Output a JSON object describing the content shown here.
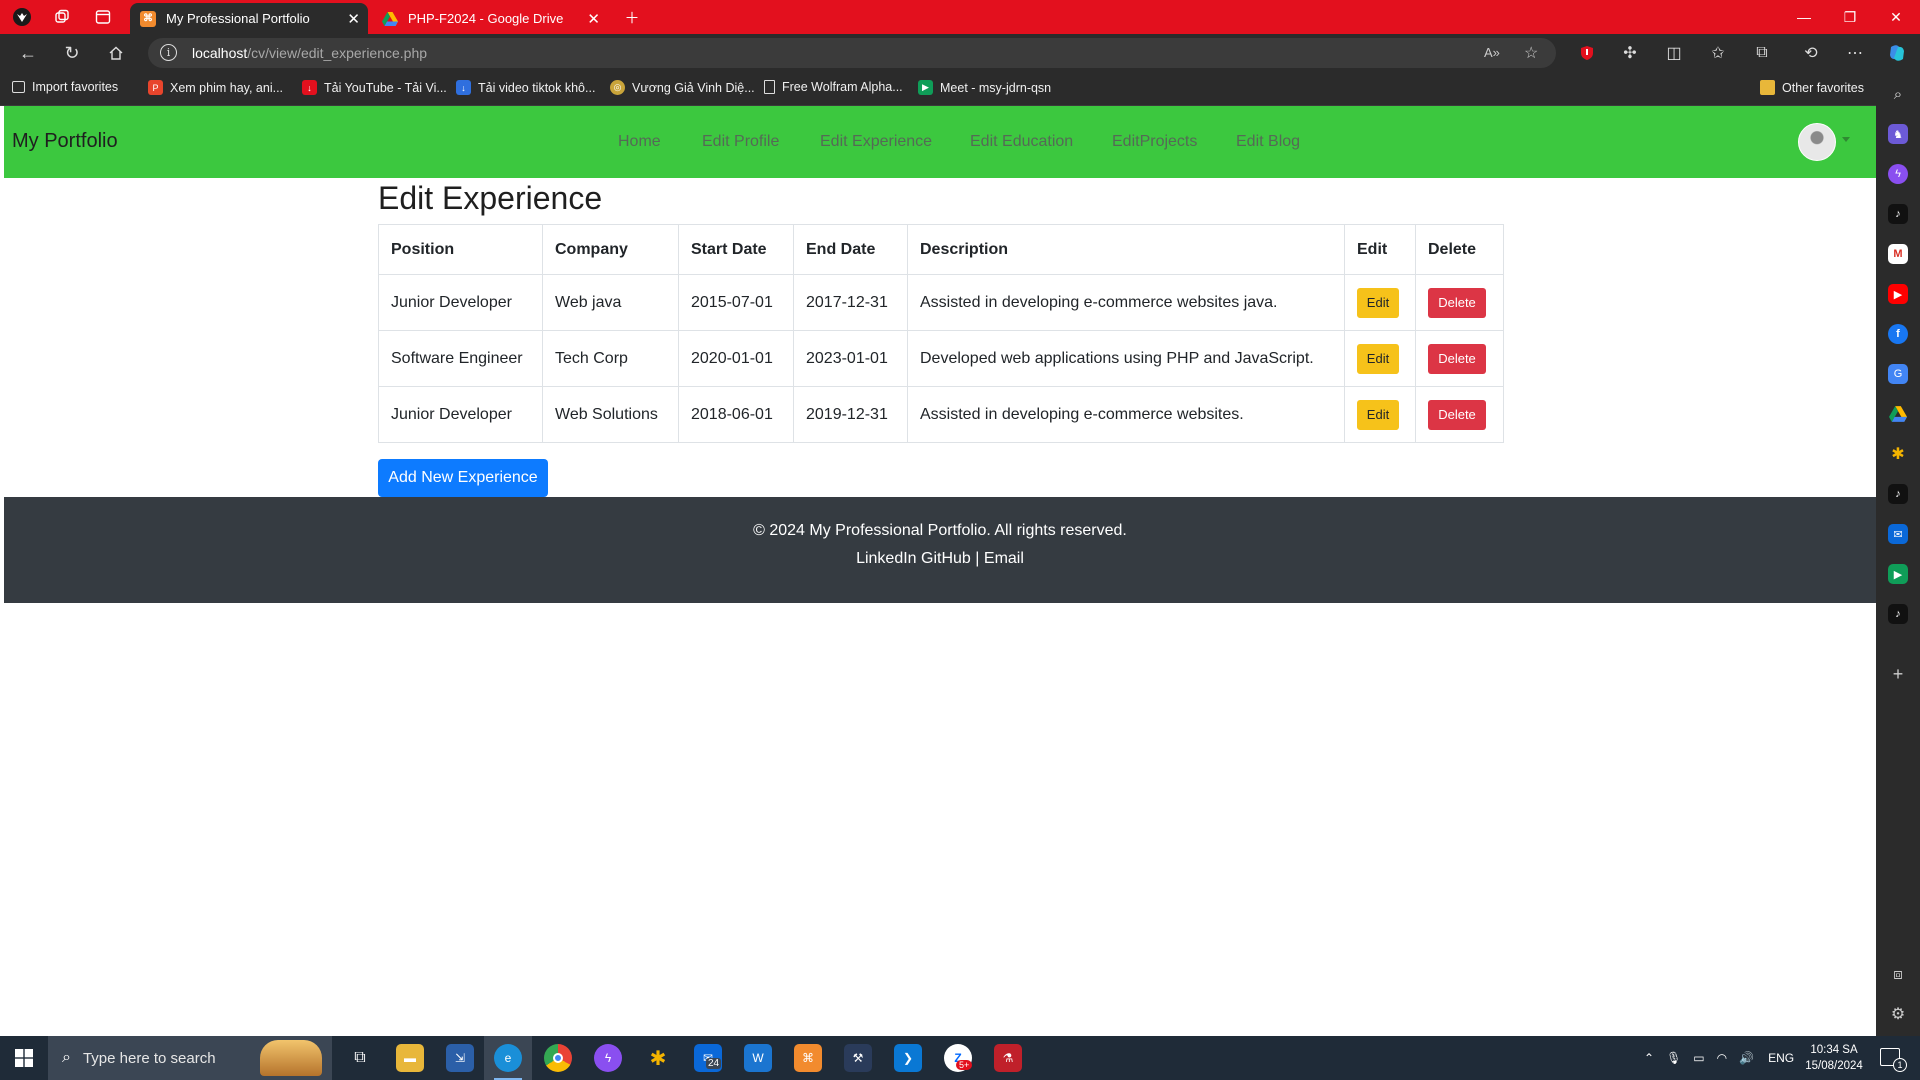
{
  "browser": {
    "tabs": [
      {
        "label": "My Professional Portfolio",
        "active": true
      },
      {
        "label": "PHP-F2024 - Google Drive",
        "active": false
      }
    ],
    "address": {
      "host": "localhost",
      "path": "/cv/view/edit_experience.php"
    },
    "favorites": [
      "Import favorites",
      "Xem phim hay, ani...",
      "Tải YouTube - Tải Vi...",
      "Tải video tiktok khô...",
      "Vương Giả Vinh Diệ...",
      "Free Wolfram Alpha...",
      "Meet - msy-jdrn-qsn"
    ],
    "other_favorites": "Other favorites"
  },
  "site": {
    "brand": "My Portfolio",
    "nav": [
      "Home",
      "Edit Profile",
      "Edit Experience",
      "Edit Education",
      "EditProjects",
      "Edit Blog"
    ],
    "page_title": "Edit Experience",
    "table": {
      "headers": [
        "Position",
        "Company",
        "Start Date",
        "End Date",
        "Description",
        "Edit",
        "Delete"
      ],
      "rows": [
        {
          "position": "Junior Developer",
          "company": "Web java",
          "start": "2015-07-01",
          "end": "2017-12-31",
          "description": "Assisted in developing e-commerce websites java."
        },
        {
          "position": "Software Engineer",
          "company": "Tech Corp",
          "start": "2020-01-01",
          "end": "2023-01-01",
          "description": "Developed web applications using PHP and JavaScript."
        },
        {
          "position": "Junior Developer",
          "company": "Web Solutions",
          "start": "2018-06-01",
          "end": "2019-12-31",
          "description": "Assisted in developing e-commerce websites."
        }
      ],
      "edit_label": "Edit",
      "delete_label": "Delete"
    },
    "add_button": "Add New Experience",
    "footer": {
      "copyright": "© 2024 My Professional Portfolio. All rights reserved.",
      "links": [
        "LinkedIn",
        "GitHub",
        "Email"
      ],
      "separator": "|"
    }
  },
  "taskbar": {
    "search_placeholder": "Type here to search",
    "language": "ENG",
    "time": "10:34 SA",
    "date": "15/08/2024",
    "badge_outlook": "24",
    "badge_zalo": "5+",
    "notification_count": "1"
  },
  "colors": {
    "titlebar": "#e3101e",
    "navbar": "#3cc83f",
    "footer": "#353b41",
    "edit_button": "#f6c21a",
    "delete_button": "#dc3545",
    "add_button": "#0d7bff"
  }
}
